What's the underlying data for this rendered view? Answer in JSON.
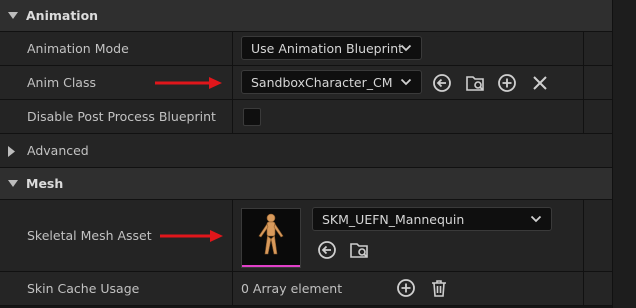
{
  "sections": {
    "animation": {
      "title": "Animation"
    },
    "mesh": {
      "title": "Mesh"
    }
  },
  "animation": {
    "mode_label": "Animation Mode",
    "mode_value": "Use Animation Blueprint",
    "anim_class_label": "Anim Class",
    "anim_class_value": "SandboxCharacter_CMC",
    "disable_pp_label": "Disable Post Process Blueprint",
    "disable_pp_checked": false,
    "advanced_label": "Advanced"
  },
  "mesh": {
    "asset_label": "Skeletal Mesh Asset",
    "asset_value": "SKM_UEFN_Mannequin",
    "skin_cache_label": "Skin Cache Usage",
    "skin_cache_value": "0 Array element"
  },
  "icons": {
    "browse": "browse-to-asset-icon",
    "find": "find-in-content-browser-icon",
    "add": "add-icon",
    "clear": "clear-icon",
    "delete": "trash-icon",
    "annotation": "red-arrow-icon"
  },
  "colors": {
    "annotation_arrow": "#e0161b",
    "thumbnail_underline": "#e040c8"
  }
}
